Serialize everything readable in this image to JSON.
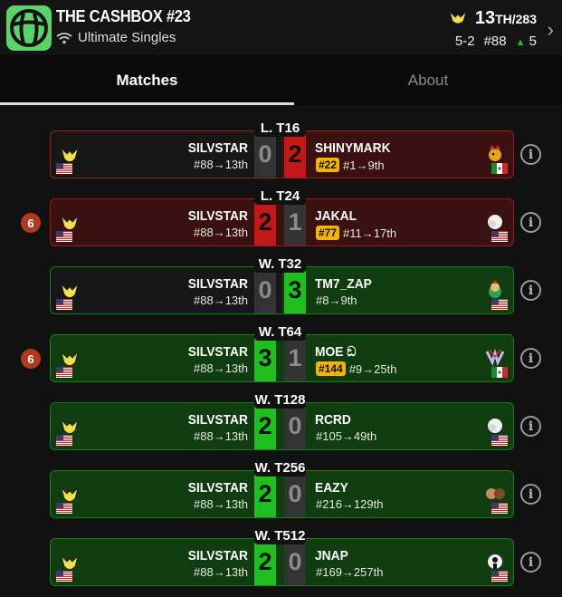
{
  "header": {
    "title": "THE CASHBOX #23",
    "subtitle": "Ultimate Singles",
    "placement": "13",
    "placement_suffix": "TH/283",
    "record": "5-2",
    "seed": "#88",
    "seed_delta": "5"
  },
  "tabs": [
    {
      "label": "Matches",
      "active": true
    },
    {
      "label": "About",
      "active": false
    }
  ],
  "player": {
    "name": "SILVSTAR",
    "seed_line": "#88→13th"
  },
  "matches": [
    {
      "round": "L. T16",
      "score_left": "0",
      "score_right": "2",
      "left_color": "grey",
      "right_color": "red",
      "card": "split-loss",
      "opponent": "SHINYMARK",
      "opp_badge": "#22",
      "opp_seed_line": "#1→9th",
      "opp_char": "bowser",
      "opp_flag": "mx",
      "dq": null
    },
    {
      "round": "L. T24",
      "score_left": "2",
      "score_right": "1",
      "left_color": "red",
      "right_color": "grey",
      "card": "loss",
      "opponent": "JAKAL",
      "opp_badge": "#77",
      "opp_seed_line": "#11→17th",
      "opp_char": "ice-climbers",
      "opp_flag": "us",
      "dq": "6"
    },
    {
      "round": "W. T32",
      "score_left": "0",
      "score_right": "3",
      "left_color": "grey",
      "right_color": "green",
      "card": "split-win",
      "opponent": "TM7_ZAP",
      "opp_badge": null,
      "opp_seed_line": "#8→9th",
      "opp_char": "bowser-jr",
      "opp_flag": "us",
      "dq": null
    },
    {
      "round": "W. T64",
      "score_left": "3",
      "score_right": "1",
      "left_color": "green",
      "right_color": "grey",
      "card": "win",
      "opponent": "MOE ඞ",
      "opp_badge": "#144",
      "opp_seed_line": "#9→25th",
      "opp_char": "mewtwo",
      "opp_flag": "mx",
      "dq": "6"
    },
    {
      "round": "W. T128",
      "score_left": "2",
      "score_right": "0",
      "left_color": "green",
      "right_color": "grey",
      "card": "win",
      "opponent": "RCRD",
      "opp_badge": null,
      "opp_seed_line": "#105→49th",
      "opp_char": "ice-climbers",
      "opp_flag": "us",
      "dq": null
    },
    {
      "round": "W. T256",
      "score_left": "2",
      "score_right": "0",
      "left_color": "green",
      "right_color": "grey",
      "card": "win",
      "opponent": "EAZY",
      "opp_badge": null,
      "opp_seed_line": "#216→129th",
      "opp_char": "duo",
      "opp_flag": "us",
      "dq": null
    },
    {
      "round": "W. T512",
      "score_left": "2",
      "score_right": "0",
      "left_color": "green",
      "right_color": "grey",
      "card": "win",
      "opponent": "JNAP",
      "opp_badge": null,
      "opp_seed_line": "#169→257th",
      "opp_char": "mr-game-and-watch",
      "opp_flag": "us",
      "dq": null
    }
  ],
  "colors": {
    "win": "#1fbf1f",
    "loss": "#c41818",
    "brand": "#5cd36a"
  }
}
